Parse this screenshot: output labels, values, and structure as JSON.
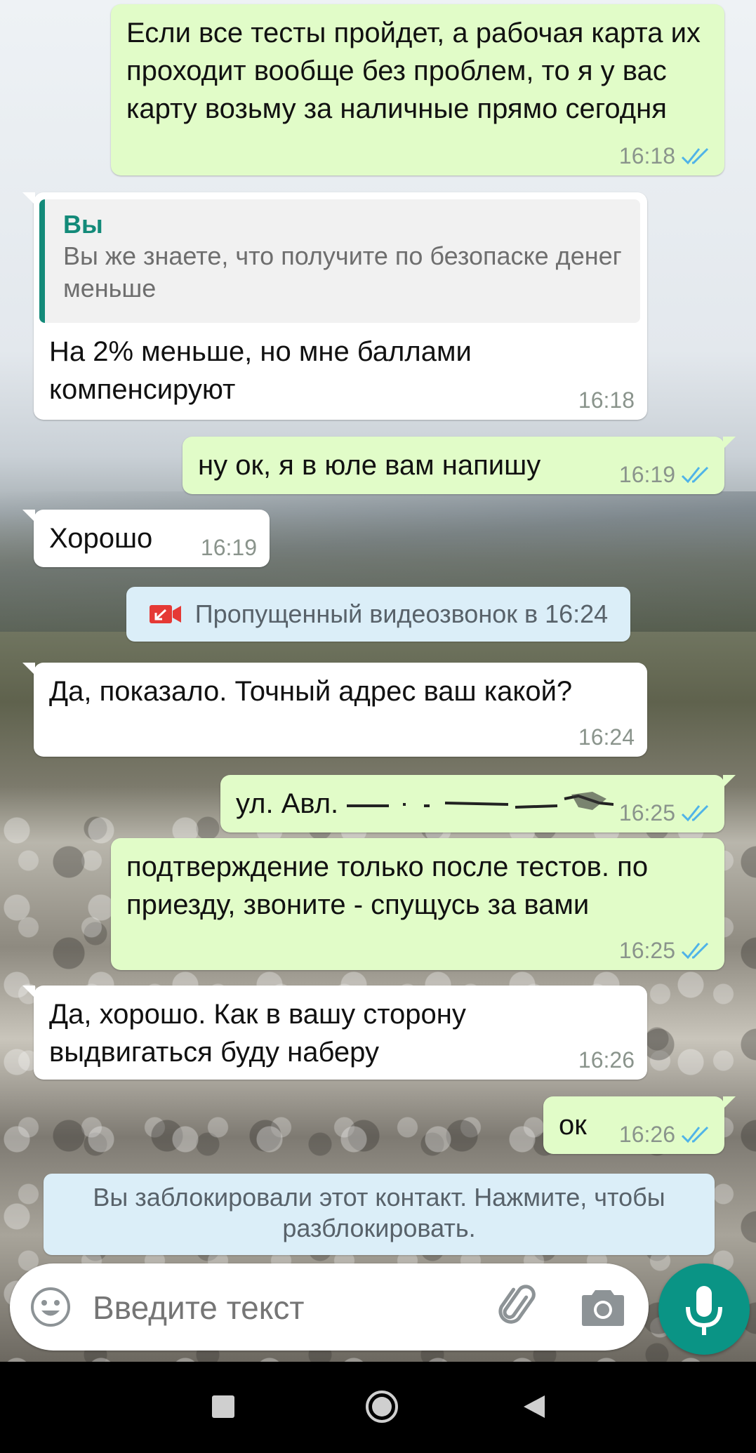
{
  "messages": [
    {
      "dir": "out",
      "text": "Если все тесты пройдет, а рабочая карта их проходит вообще без проблем, то я у вас карту возьму за наличные прямо сегодня",
      "time": "16:18"
    },
    {
      "dir": "in",
      "reply_author": "Вы",
      "reply_text": "Вы же знаете, что получите по безопаске денег меньше",
      "text": "На 2% меньше, но мне баллами компенсируют",
      "time": "16:18"
    },
    {
      "dir": "out",
      "text": "ну ок, я в юле вам напишу",
      "time": "16:19"
    },
    {
      "dir": "in",
      "text": "Хорошо",
      "time": "16:19"
    },
    {
      "dir": "in",
      "text": "Да, показало. Точный адрес ваш какой?",
      "time": "16:24"
    },
    {
      "dir": "out",
      "text": "ул. Авл.",
      "time": "16:25"
    },
    {
      "dir": "out",
      "text": "подтверждение только после тестов. по приезду, звоните - спущусь за вами",
      "time": "16:25"
    },
    {
      "dir": "in",
      "text": "Да, хорошо. Как в вашу сторону выдвигаться буду наберу",
      "time": "16:26"
    },
    {
      "dir": "out",
      "text": "ок",
      "time": "16:26"
    }
  ],
  "missed_call": {
    "text": "Пропущенный видеозвонок в 16:24",
    "icon": "missed-video-call-icon",
    "color": "#e53935"
  },
  "blocked_notice": {
    "line1": "Вы заблокировали этот контакт. Нажмите, чтобы",
    "line2": "разблокировать."
  },
  "composer": {
    "placeholder": "Введите текст",
    "icons": [
      "emoji-icon",
      "attach-icon",
      "camera-icon",
      "mic-icon"
    ]
  },
  "colors": {
    "outgoing": "#e1fcc8",
    "incoming": "#ffffff",
    "accent": "#0a9485",
    "read_ticks": "#4fb3e8"
  }
}
